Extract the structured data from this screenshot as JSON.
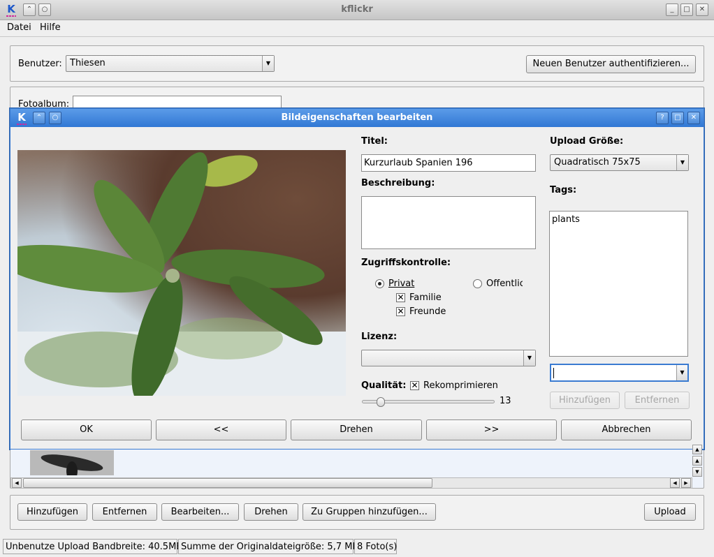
{
  "window": {
    "title": "kflickr",
    "menu": [
      "Datei",
      "Hilfe"
    ]
  },
  "user": {
    "label": "Benutzer:",
    "selected": "Thiesen",
    "auth_button": "Neuen Benutzer authentifizieren..."
  },
  "album": {
    "label": "Fotoalbum:",
    "selected": ""
  },
  "dialog": {
    "title": "Bildeigenschaften bearbeiten",
    "title_label": "Titel:",
    "title_value": "Kurzurlaub Spanien 196",
    "description_label": "Beschreibung:",
    "description_value": "",
    "access_label": "Zugriffskontrolle:",
    "private_label": "Privat",
    "public_label": "Öffentlic",
    "family_label": "Familie",
    "friends_label": "Freunde",
    "license_label": "Lizenz:",
    "license_value": "",
    "quality_label": "Qualität:",
    "recompress_label": "Rekomprimieren",
    "quality_value": "13",
    "upload_size_label": "Upload Größe:",
    "upload_size_value": "Quadratisch 75x75",
    "tags_label": "Tags:",
    "tags": [
      "plants"
    ],
    "tag_input": "",
    "tag_add_button": "Hinzufügen",
    "tag_remove_button": "Entfernen",
    "buttons": {
      "ok": "OK",
      "prev": "<<",
      "rotate": "Drehen",
      "next": ">>",
      "cancel": "Abbrechen"
    },
    "state": {
      "private": true,
      "public": false,
      "family": true,
      "friends": true,
      "recompress": true
    }
  },
  "actions": {
    "add": "Hinzufügen",
    "remove": "Entfernen",
    "edit": "Bearbeiten...",
    "rotate": "Drehen",
    "add_to_groups": "Zu Gruppen hinzufügen...",
    "upload": "Upload"
  },
  "status": {
    "bandwidth": "Unbenutze Upload Bandbreite: 40.5MB",
    "total_size": "Summe der Originaldateigröße: 5,7 MB",
    "count": "8 Foto(s)"
  },
  "colors": {
    "dialog_titlebar": "#3a7bd1",
    "focus_accent": "#3a7bd1"
  }
}
